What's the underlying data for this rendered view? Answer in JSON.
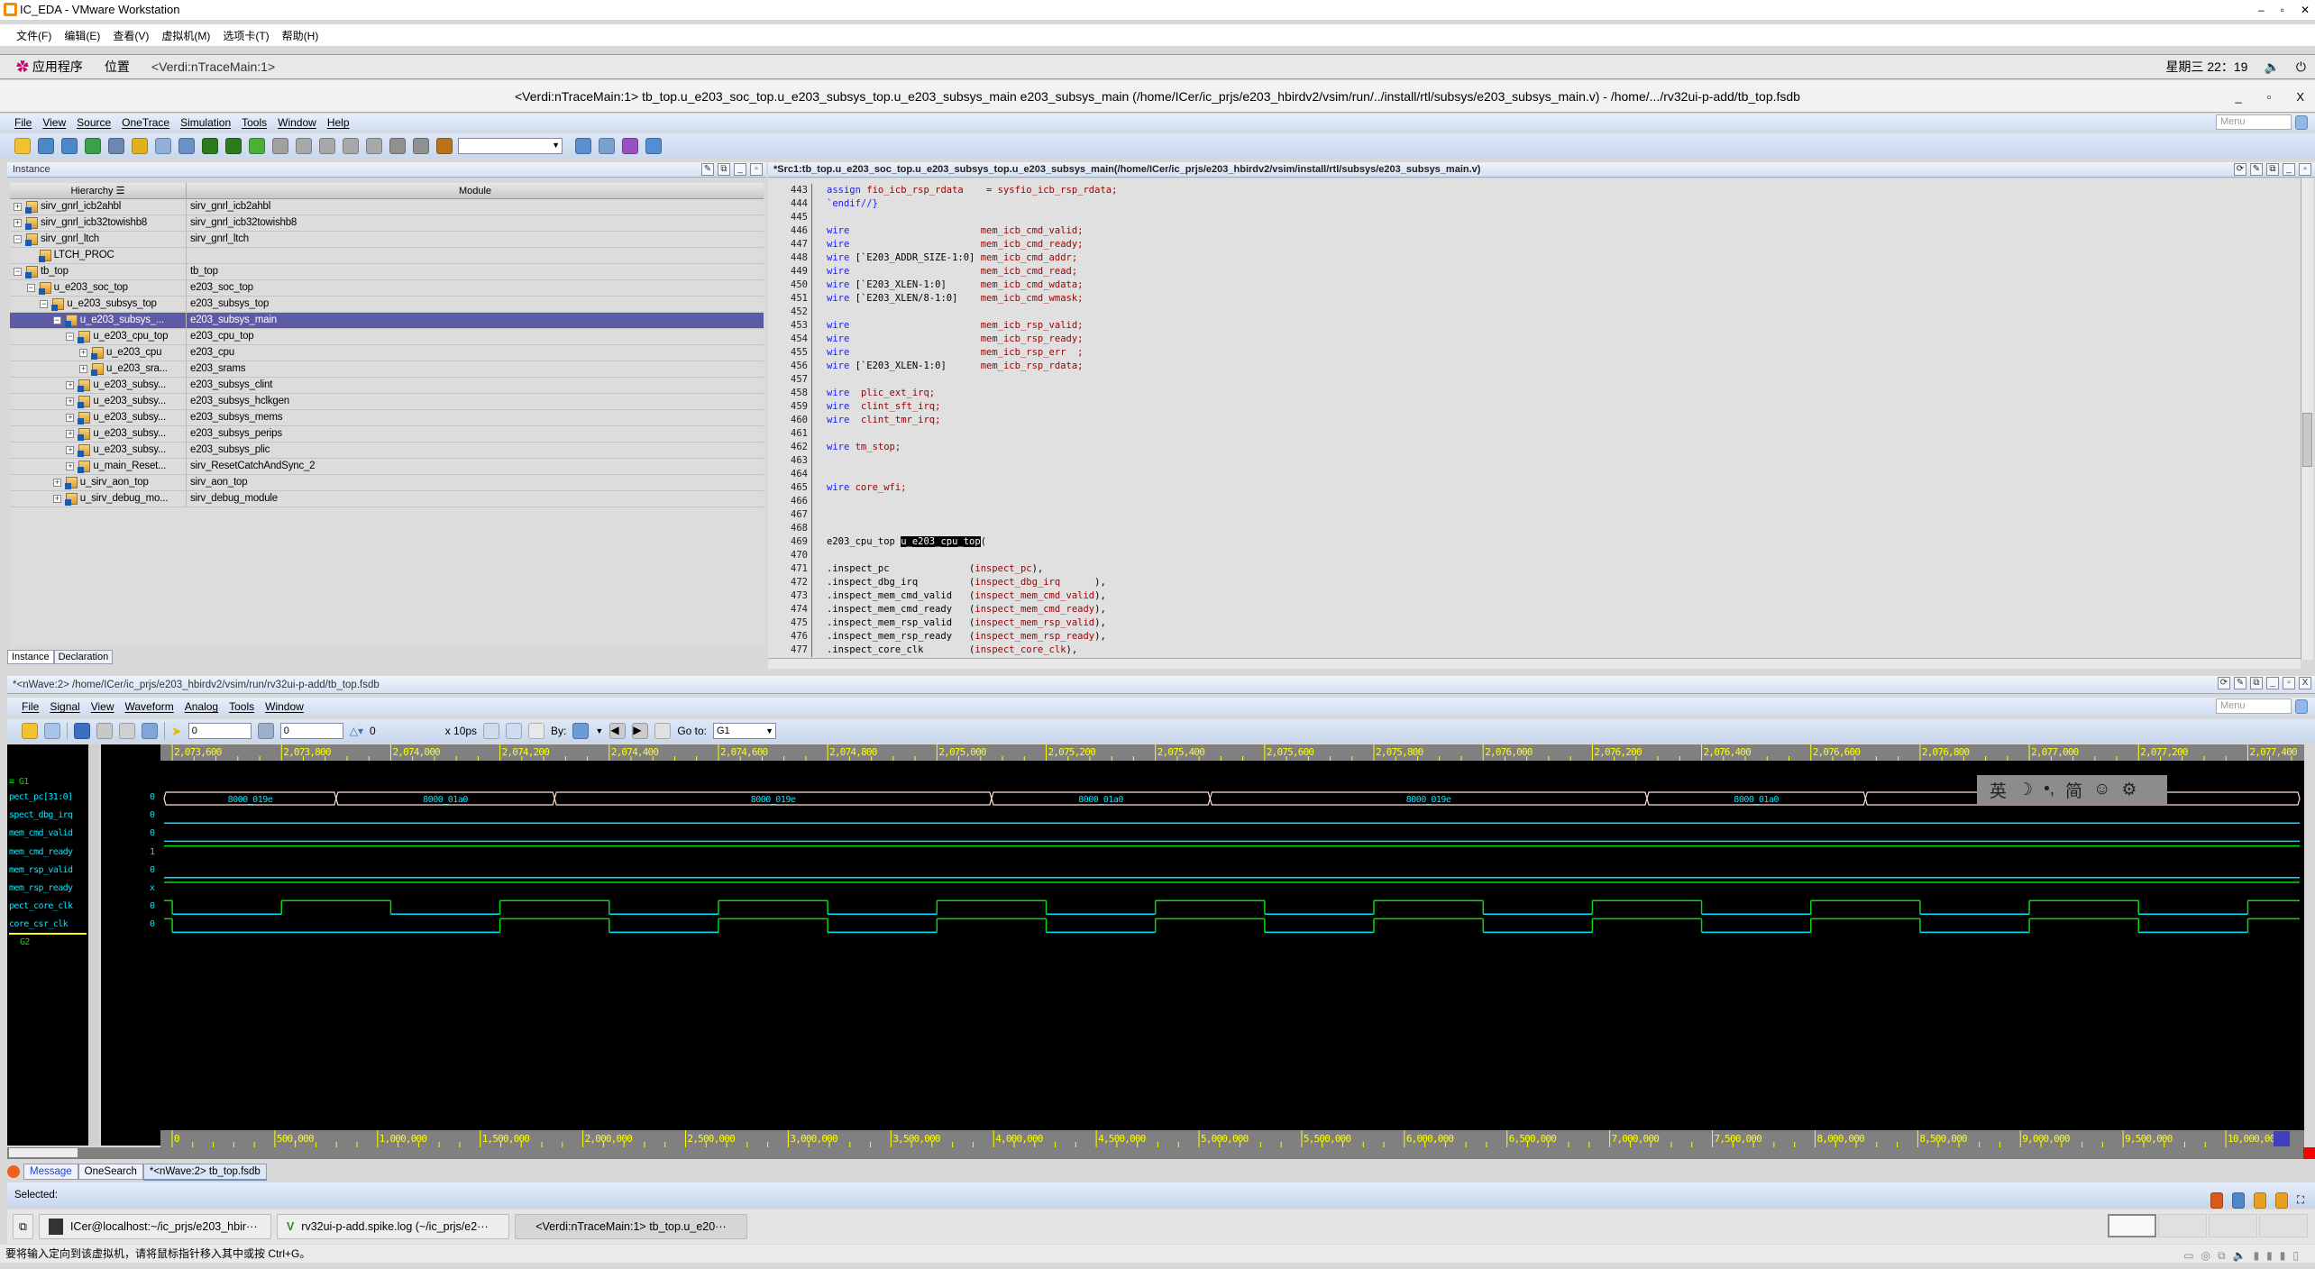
{
  "vmware": {
    "title": "IC_EDA - VMware Workstation",
    "menu": [
      "文件(F)",
      "编辑(E)",
      "查看(V)",
      "虚拟机(M)",
      "选项卡(T)",
      "帮助(H)"
    ],
    "status_message": "要将输入定向到该虚拟机，请将鼠标指针移入其中或按 Ctrl+G。"
  },
  "gnome": {
    "apps": "应用程序",
    "places": "位置",
    "window": "<Verdi:nTraceMain:1>",
    "clock": "星期三 22：19"
  },
  "verdi": {
    "title": "<Verdi:nTraceMain:1> tb_top.u_e203_soc_top.u_e203_subsys_top.u_e203_subsys_main e203_subsys_main (/home/ICer/ic_prjs/e203_hbirdv2/vsim/run/../install/rtl/subsys/e203_subsys_main.v) - /home/.../rv32ui-p-add/tb_top.fsdb",
    "menu": [
      "File",
      "View",
      "Source",
      "OneTrace",
      "Simulation",
      "Tools",
      "Window",
      "Help"
    ],
    "menu_search_placeholder": "Menu",
    "toolbar_icons": [
      {
        "name": "open-folder",
        "color": "#f2c230"
      },
      {
        "name": "hierarchy-window",
        "color": "#4d87c7"
      },
      {
        "name": "schematic-window",
        "color": "#4d87c7"
      },
      {
        "name": "flow-view",
        "color": "#3aa04a"
      },
      {
        "name": "state-machine",
        "color": "#6c87b0"
      },
      {
        "name": "open-file",
        "color": "#e0b020"
      },
      {
        "name": "edit-source",
        "color": "#8fb0d8"
      },
      {
        "name": "trace-driver",
        "color": "#6d8fc7"
      },
      {
        "name": "trace-back",
        "color": "#2c7a1e"
      },
      {
        "name": "trace-forward",
        "color": "#2c7a1e"
      },
      {
        "name": "arrow-left",
        "color": "#4caf38"
      },
      {
        "name": "arrow-right",
        "color": "#a0a0a0"
      },
      {
        "name": "driver-d",
        "color": "#a8a8a8"
      },
      {
        "name": "load-l",
        "color": "#a8a8a8"
      },
      {
        "name": "arrow-up",
        "color": "#a8a8a8"
      },
      {
        "name": "arrow-down",
        "color": "#a8a8a8"
      },
      {
        "name": "push-down",
        "color": "#909090"
      },
      {
        "name": "pop-up",
        "color": "#909090"
      },
      {
        "name": "bookmark",
        "color": "#b87318"
      }
    ],
    "toolbar_icons_right": [
      {
        "name": "search-forward",
        "color": "#5a90d0"
      },
      {
        "name": "search-find",
        "color": "#7aa0d0"
      },
      {
        "name": "apps-tool",
        "color": "#9a4fc0"
      },
      {
        "name": "sim-tool",
        "color": "#5090d0"
      }
    ]
  },
  "instance_panel": {
    "title": "Instance",
    "columns": [
      "Hierarchy",
      "Module"
    ],
    "rows": [
      {
        "name": "sirv_gnrl_icb2ahbl",
        "module": "sirv_gnrl_icb2ahbl",
        "level": 0,
        "expander": "+"
      },
      {
        "name": "sirv_gnrl_icb32towishb8",
        "module": "sirv_gnrl_icb32towishb8",
        "level": 0,
        "expander": "+"
      },
      {
        "name": "sirv_gnrl_ltch",
        "module": "sirv_gnrl_ltch",
        "level": 0,
        "expander": "-"
      },
      {
        "name": "LTCH_PROC",
        "module": "",
        "level": 1,
        "expander": ""
      },
      {
        "name": "tb_top",
        "module": "tb_top",
        "level": 0,
        "expander": "-"
      },
      {
        "name": "u_e203_soc_top",
        "module": "e203_soc_top",
        "level": 1,
        "expander": "-"
      },
      {
        "name": "u_e203_subsys_top",
        "module": "e203_subsys_top",
        "level": 2,
        "expander": "-"
      },
      {
        "name": "u_e203_subsys_...",
        "module": "e203_subsys_main",
        "level": 3,
        "expander": "-",
        "selected": true
      },
      {
        "name": "u_e203_cpu_top",
        "module": "e203_cpu_top",
        "level": 4,
        "expander": "-"
      },
      {
        "name": "u_e203_cpu",
        "module": "e203_cpu",
        "level": 5,
        "expander": "+"
      },
      {
        "name": "u_e203_sra...",
        "module": "e203_srams",
        "level": 5,
        "expander": "+"
      },
      {
        "name": "u_e203_subsy...",
        "module": "e203_subsys_clint",
        "level": 4,
        "expander": "+"
      },
      {
        "name": "u_e203_subsy...",
        "module": "e203_subsys_hclkgen",
        "level": 4,
        "expander": "+"
      },
      {
        "name": "u_e203_subsy...",
        "module": "e203_subsys_mems",
        "level": 4,
        "expander": "+"
      },
      {
        "name": "u_e203_subsy...",
        "module": "e203_subsys_perips",
        "level": 4,
        "expander": "+"
      },
      {
        "name": "u_e203_subsy...",
        "module": "e203_subsys_plic",
        "level": 4,
        "expander": "+"
      },
      {
        "name": "u_main_Reset...",
        "module": "sirv_ResetCatchAndSync_2",
        "level": 4,
        "expander": "+"
      },
      {
        "name": "u_sirv_aon_top",
        "module": "sirv_aon_top",
        "level": 3,
        "expander": "+"
      },
      {
        "name": "u_sirv_debug_mo...",
        "module": "sirv_debug_module",
        "level": 3,
        "expander": "+"
      }
    ],
    "tabs": [
      "Instance",
      "Declaration"
    ]
  },
  "source_panel": {
    "title": "*Src1:tb_top.u_e203_soc_top.u_e203_subsys_top.u_e203_subsys_main(/home/ICer/ic_prjs/e203_hbirdv2/vsim/install/rtl/subsys/e203_subsys_main.v)",
    "lines": [
      {
        "n": "443",
        "seg": [
          [
            "assign ",
            "keyword"
          ],
          [
            "fio_icb_rsp_rdata    = sysfio_icb_rsp_rdata;",
            "identifier"
          ]
        ]
      },
      {
        "n": "444",
        "seg": [
          [
            "`endif//}",
            "keyword"
          ]
        ]
      },
      {
        "n": "445",
        "seg": []
      },
      {
        "n": "446",
        "seg": [
          [
            "wire",
            "keyword"
          ],
          [
            "                       ",
            "plain"
          ],
          [
            "mem_icb_cmd_valid;",
            "identifier"
          ]
        ]
      },
      {
        "n": "447",
        "seg": [
          [
            "wire",
            "keyword"
          ],
          [
            "                       ",
            "plain"
          ],
          [
            "mem_icb_cmd_ready;",
            "identifier"
          ]
        ]
      },
      {
        "n": "448",
        "seg": [
          [
            "wire",
            "keyword"
          ],
          [
            " [`E203_ADDR_SIZE-1:0] ",
            "plain"
          ],
          [
            "mem_icb_cmd_addr;",
            "identifier"
          ]
        ]
      },
      {
        "n": "449",
        "seg": [
          [
            "wire",
            "keyword"
          ],
          [
            "                       ",
            "plain"
          ],
          [
            "mem_icb_cmd_read;",
            "identifier"
          ]
        ]
      },
      {
        "n": "450",
        "seg": [
          [
            "wire",
            "keyword"
          ],
          [
            " [`E203_XLEN-1:0]      ",
            "plain"
          ],
          [
            "mem_icb_cmd_wdata;",
            "identifier"
          ]
        ]
      },
      {
        "n": "451",
        "seg": [
          [
            "wire",
            "keyword"
          ],
          [
            " [`E203_XLEN/8-1:0]    ",
            "plain"
          ],
          [
            "mem_icb_cmd_wmask;",
            "identifier"
          ]
        ]
      },
      {
        "n": "452",
        "seg": []
      },
      {
        "n": "453",
        "seg": [
          [
            "wire",
            "keyword"
          ],
          [
            "                       ",
            "plain"
          ],
          [
            "mem_icb_rsp_valid;",
            "identifier"
          ]
        ]
      },
      {
        "n": "454",
        "seg": [
          [
            "wire",
            "keyword"
          ],
          [
            "                       ",
            "plain"
          ],
          [
            "mem_icb_rsp_ready;",
            "identifier"
          ]
        ]
      },
      {
        "n": "455",
        "seg": [
          [
            "wire",
            "keyword"
          ],
          [
            "                       ",
            "plain"
          ],
          [
            "mem_icb_rsp_err  ;",
            "identifier"
          ]
        ]
      },
      {
        "n": "456",
        "seg": [
          [
            "wire",
            "keyword"
          ],
          [
            " [`E203_XLEN-1:0]      ",
            "plain"
          ],
          [
            "mem_icb_rsp_rdata;",
            "identifier"
          ]
        ]
      },
      {
        "n": "457",
        "seg": []
      },
      {
        "n": "458",
        "seg": [
          [
            "wire  ",
            "keyword"
          ],
          [
            "plic_ext_irq;",
            "identifier"
          ]
        ]
      },
      {
        "n": "459",
        "seg": [
          [
            "wire  ",
            "keyword"
          ],
          [
            "clint_sft_irq;",
            "identifier"
          ]
        ]
      },
      {
        "n": "460",
        "seg": [
          [
            "wire  ",
            "keyword"
          ],
          [
            "clint_tmr_irq;",
            "identifier"
          ]
        ]
      },
      {
        "n": "461",
        "seg": []
      },
      {
        "n": "462",
        "seg": [
          [
            "wire ",
            "keyword"
          ],
          [
            "tm_stop;",
            "identifier"
          ]
        ]
      },
      {
        "n": "463",
        "seg": []
      },
      {
        "n": "464",
        "seg": []
      },
      {
        "n": "465",
        "seg": [
          [
            "wire ",
            "keyword"
          ],
          [
            "core_wfi;",
            "identifier"
          ]
        ]
      },
      {
        "n": "466",
        "seg": []
      },
      {
        "n": "467",
        "seg": []
      },
      {
        "n": "468",
        "seg": []
      },
      {
        "n": "469",
        "seg": [
          [
            "e203_cpu_top ",
            "plain"
          ],
          [
            "u_e203_cpu_top",
            "highlight"
          ],
          [
            "(",
            "plain"
          ]
        ]
      },
      {
        "n": "470",
        "seg": []
      },
      {
        "n": "471",
        "seg": [
          [
            ".inspect_pc              ",
            "plain"
          ],
          [
            "(",
            "plain"
          ],
          [
            "inspect_pc",
            "identifier"
          ],
          [
            "),",
            "plain"
          ]
        ]
      },
      {
        "n": "472",
        "seg": [
          [
            ".inspect_dbg_irq         ",
            "plain"
          ],
          [
            "(",
            "plain"
          ],
          [
            "inspect_dbg_irq      ",
            "identifier"
          ],
          [
            "),",
            "plain"
          ]
        ]
      },
      {
        "n": "473",
        "seg": [
          [
            ".inspect_mem_cmd_valid   ",
            "plain"
          ],
          [
            "(",
            "plain"
          ],
          [
            "inspect_mem_cmd_valid",
            "identifier"
          ],
          [
            "),",
            "plain"
          ]
        ]
      },
      {
        "n": "474",
        "seg": [
          [
            ".inspect_mem_cmd_ready   ",
            "plain"
          ],
          [
            "(",
            "plain"
          ],
          [
            "inspect_mem_cmd_ready",
            "identifier"
          ],
          [
            "),",
            "plain"
          ]
        ]
      },
      {
        "n": "475",
        "seg": [
          [
            ".inspect_mem_rsp_valid   ",
            "plain"
          ],
          [
            "(",
            "plain"
          ],
          [
            "inspect_mem_rsp_valid",
            "identifier"
          ],
          [
            "),",
            "plain"
          ]
        ]
      },
      {
        "n": "476",
        "seg": [
          [
            ".inspect_mem_rsp_ready   ",
            "plain"
          ],
          [
            "(",
            "plain"
          ],
          [
            "inspect_mem_rsp_ready",
            "identifier"
          ],
          [
            "),",
            "plain"
          ]
        ]
      },
      {
        "n": "477",
        "seg": [
          [
            ".inspect_core_clk        ",
            "plain"
          ],
          [
            "(",
            "plain"
          ],
          [
            "inspect_core_clk",
            "identifier"
          ],
          [
            "),",
            "plain"
          ]
        ]
      }
    ]
  },
  "nwave": {
    "title": "*<nWave:2> /home/ICer/ic_prjs/e203_hbirdv2/vsim/run/rv32ui-p-add/tb_top.fsdb",
    "menu": [
      "File",
      "Signal",
      "View",
      "Waveform",
      "Analog",
      "Tools",
      "Window"
    ],
    "menu_search_placeholder": "Menu",
    "cursor_time": "0",
    "marker_time": "0",
    "delta": "0",
    "time_unit": "x 10ps",
    "by_label": "By:",
    "goto_label": "Go to:",
    "goto_value": "G1",
    "groups": [
      "G1",
      "G2"
    ],
    "signals": [
      {
        "name": "pect_pc[31:0]",
        "value": "0",
        "type": "bus"
      },
      {
        "name": "spect_dbg_irq",
        "value": "0",
        "type": "const",
        "level": 0
      },
      {
        "name": "mem_cmd_valid",
        "value": "0",
        "type": "const",
        "level": 0
      },
      {
        "name": "mem_cmd_ready",
        "value": "1",
        "type": "const",
        "level": 1
      },
      {
        "name": "mem_rsp_valid",
        "value": "0",
        "type": "const",
        "level": 0
      },
      {
        "name": "mem_rsp_ready",
        "value": "x",
        "type": "const",
        "level": 1
      },
      {
        "name": "pect_core_clk",
        "value": "0",
        "type": "clock",
        "initial": 1,
        "edges": [
          2073600,
          2073800,
          2074000,
          2074200,
          2074400,
          2074600,
          2074800,
          2075000,
          2075200,
          2075400,
          2075600,
          2075800,
          2076000,
          2076200,
          2076400,
          2076600,
          2076800,
          2077000,
          2077200,
          2077400
        ]
      },
      {
        "name": "core_csr_clk",
        "value": "0",
        "type": "clock",
        "initial": 1,
        "edges": [
          2073600,
          2074200,
          2074400,
          2074600,
          2074800,
          2075000,
          2075200,
          2075400,
          2075600,
          2075800,
          2076000,
          2076200,
          2076400,
          2076600,
          2076800,
          2077000,
          2077200,
          2077400
        ]
      }
    ],
    "bus_segments": [
      {
        "start": 2073585,
        "end": 2073900,
        "value": "8000_019e"
      },
      {
        "start": 2073900,
        "end": 2074300,
        "value": "8000_01a0"
      },
      {
        "start": 2074300,
        "end": 2075100,
        "value": "8000_019e"
      },
      {
        "start": 2075100,
        "end": 2075500,
        "value": "8000_01a0"
      },
      {
        "start": 2075500,
        "end": 2076300,
        "value": "8000_019e"
      },
      {
        "start": 2076300,
        "end": 2076700,
        "value": "8000_01a0"
      },
      {
        "start": 2076700,
        "end": 2077495,
        "value": ""
      }
    ],
    "view_range": [
      2073585,
      2077495
    ],
    "top_ruler_labels": [
      "2,073,600",
      "2,073,800",
      "2,074,000",
      "2,074,200",
      "2,074,400",
      "2,074,600",
      "2,074,800",
      "2,075,000",
      "2,075,200",
      "2,075,400",
      "2,075,600",
      "2,075,800",
      "2,076,000",
      "2,076,200",
      "2,076,400",
      "2,076,600",
      "2,076,800",
      "2,077,000",
      "2,077,200",
      "2,077,400"
    ],
    "overview_range": [
      0,
      10250000
    ],
    "bottom_ruler_labels": [
      "0",
      "500,000",
      "1,000,000",
      "1,500,000",
      "2,000,000",
      "2,500,000",
      "3,000,000",
      "3,500,000",
      "4,000,000",
      "4,500,000",
      "5,000,000",
      "5,500,000",
      "6,000,000",
      "6,500,000",
      "7,000,000",
      "7,500,000",
      "8,000,000",
      "8,500,000",
      "9,000,000",
      "9,500,000",
      "10,000,000"
    ],
    "colors": {
      "low": "#00e5ff",
      "high": "#00e000",
      "bus": "#ffe4d4",
      "ruler_bg": "#808080",
      "ruler_fg": "#ffff00"
    }
  },
  "ime_toolbar": [
    "英",
    "☽",
    "•,",
    "简",
    "☺",
    "⚙"
  ],
  "bottom_tabs": [
    "Message",
    "OneSearch",
    "*<nWave:2> tb_top.fsdb"
  ],
  "selected_label": "Selected:",
  "taskbar": [
    "ICer@localhost:~/ic_prjs/e203_hbir···",
    "rv32ui-p-add.spike.log (~/ic_prjs/e2···",
    "<Verdi:nTraceMain:1> tb_top.u_e20···"
  ]
}
